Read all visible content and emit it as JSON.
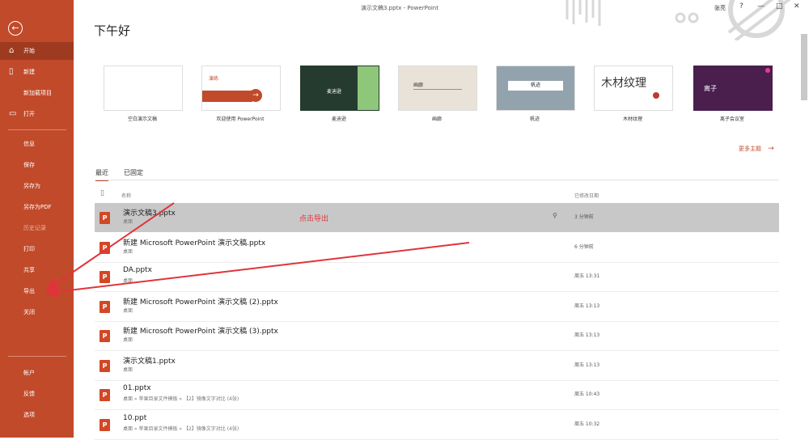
{
  "window": {
    "title": "演示文稿3.pptx - PowerPoint",
    "user": "张亮",
    "controls": [
      "?",
      "—",
      "□",
      "✕"
    ]
  },
  "sidebar": {
    "back_icon": "back-arrow-icon",
    "items": [
      {
        "label": "开始",
        "icon": "home-icon",
        "active": true
      },
      {
        "label": "新建",
        "icon": "new-file-icon"
      },
      {
        "label": "新加载项目"
      },
      {
        "label": "打开",
        "icon": "folder-icon"
      },
      {
        "label": "信息"
      },
      {
        "label": "保存"
      },
      {
        "label": "另存为"
      },
      {
        "label": "另存为PDF"
      },
      {
        "label": "历史记录",
        "dim": true
      },
      {
        "label": "打印"
      },
      {
        "label": "共享"
      },
      {
        "label": "导出"
      },
      {
        "label": "关闭"
      }
    ],
    "bottom_items": [
      {
        "label": "帐户"
      },
      {
        "label": "反馈"
      },
      {
        "label": "选项"
      }
    ]
  },
  "main": {
    "greeting": "下午好",
    "templates": [
      {
        "label": "空白演示文稿",
        "thumb_text": ""
      },
      {
        "label": "欢迎使用 PowerPoint",
        "thumb_text": "演练"
      },
      {
        "label": "麦迪逊",
        "thumb_text": "麦迪逊"
      },
      {
        "label": "画廊",
        "thumb_text": "画廊"
      },
      {
        "label": "帆迹",
        "thumb_text": "帆迹"
      },
      {
        "label": "木材纹理",
        "thumb_text": "木材纹理"
      },
      {
        "label": "离子会议室",
        "thumb_text": "离子"
      }
    ],
    "more_themes": "更多主题",
    "tabs": [
      "最近",
      "已固定"
    ],
    "columns": {
      "name": "名称",
      "date": "已修改日期"
    },
    "hint": "点击导出",
    "files": [
      {
        "name": "演示文稿3.pptx",
        "path": "桌面",
        "date": "3 分钟前",
        "selected": true
      },
      {
        "name": "新建 Microsoft PowerPoint 演示文稿.pptx",
        "path": "桌面",
        "date": "6 分钟前"
      },
      {
        "name": "DA.pptx",
        "path": "桌面",
        "date": "周五 13:31"
      },
      {
        "name": "新建 Microsoft PowerPoint 演示文稿 (2).pptx",
        "path": "桌面",
        "date": "周五 13:13"
      },
      {
        "name": "新建 Microsoft PowerPoint 演示文稿 (3).pptx",
        "path": "桌面",
        "date": "周五 13:13"
      },
      {
        "name": "演示文稿1.pptx",
        "path": "桌面",
        "date": "周五 13:13"
      },
      {
        "name": "01.pptx",
        "path": "桌面 » 苹果目录文件模板 » 【2】镜像文字对比 (4张)",
        "date": "周五 10:43"
      },
      {
        "name": "10.ppt",
        "path": "桌面 » 苹果目录文件模板 » 【2】镜像文字对比 (4张)",
        "date": "周五 10:32"
      }
    ]
  },
  "colors": {
    "accent": "#c14a2a",
    "accent_dark": "#9e3a1f",
    "selected_row": "#c8c8c8",
    "arrow": "#e0343a"
  }
}
